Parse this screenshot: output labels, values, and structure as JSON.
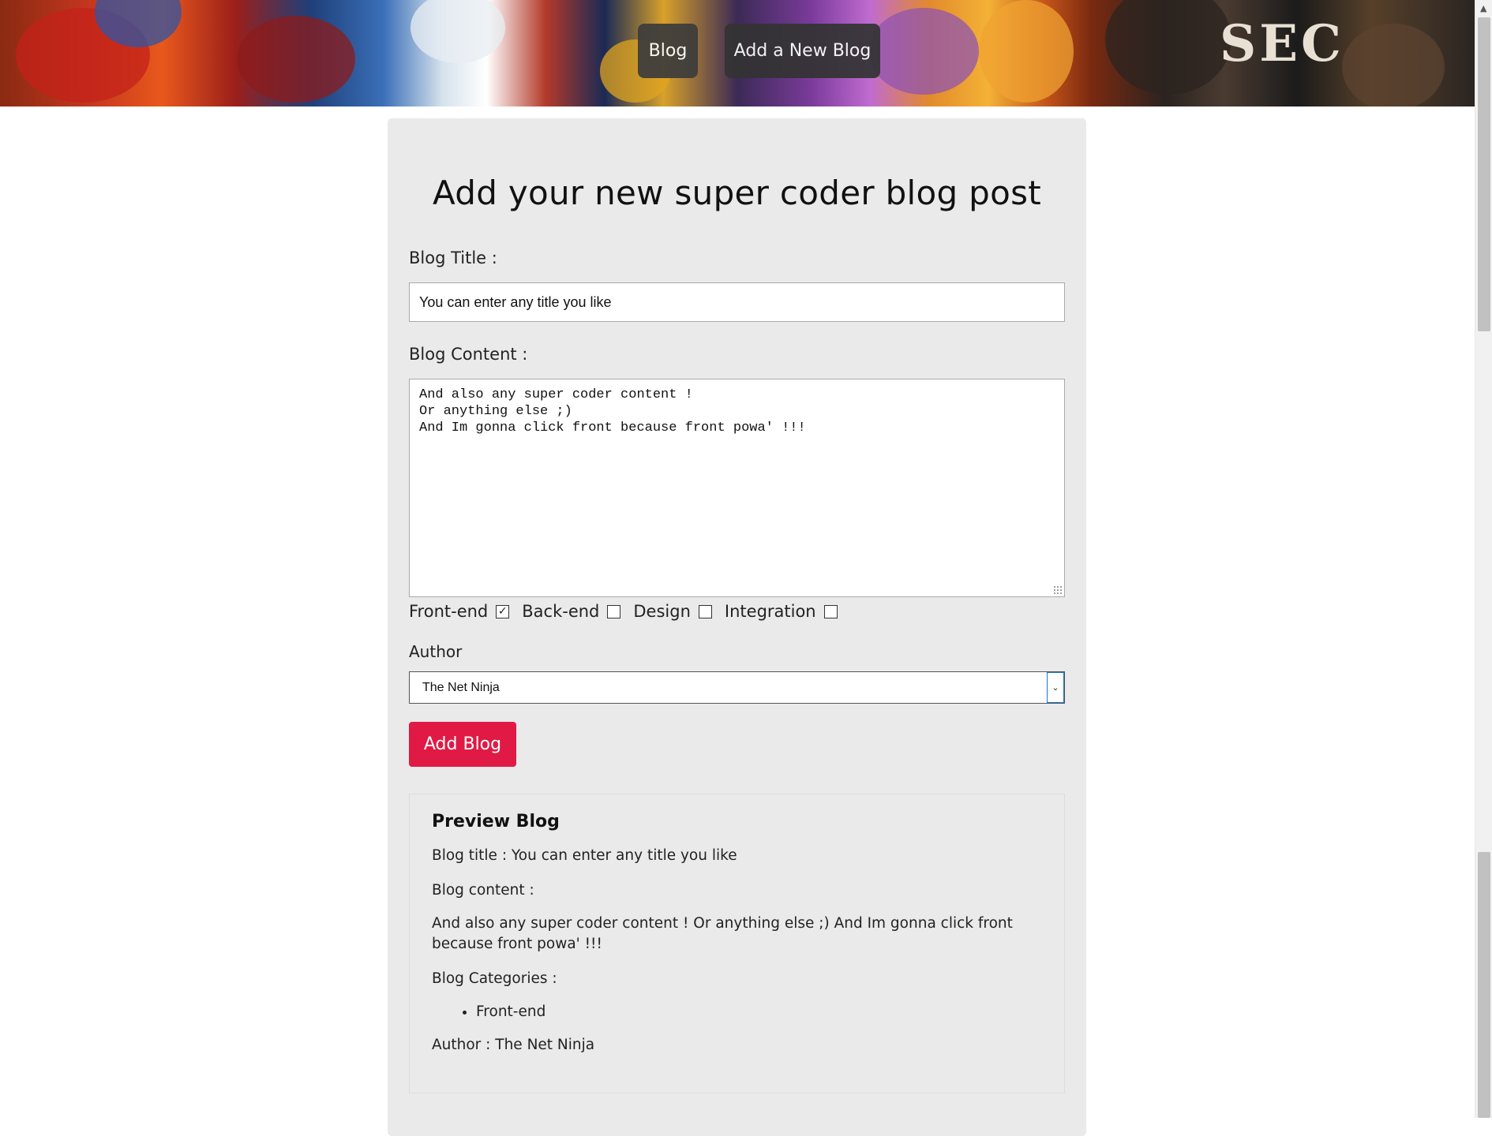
{
  "nav": {
    "blog_label": "Blog",
    "add_label": "Add a New Blog"
  },
  "form": {
    "heading": "Add your new super coder blog post",
    "title_label": "Blog Title :",
    "title_value": "You can enter any title you like",
    "content_label": "Blog Content :",
    "content_lines": [
      "And also any super coder content !",
      "Or anything else ;)",
      "And Im gonna click front because front powa' !!!"
    ],
    "categories": [
      {
        "label": "Front-end",
        "checked": true
      },
      {
        "label": "Back-end",
        "checked": false
      },
      {
        "label": "Design",
        "checked": false
      },
      {
        "label": "Integration",
        "checked": false
      }
    ],
    "author_label": "Author",
    "author_value": "The Net Ninja",
    "submit_label": "Add Blog"
  },
  "preview": {
    "heading": "Preview Blog",
    "title_line": "Blog title : You can enter any title you like",
    "content_label": "Blog content :",
    "content_text": "And also any super coder content ! Or anything else ;) And Im gonna click front because front powa' !!!",
    "categories_label": "Blog Categories :",
    "categories": [
      "Front-end"
    ],
    "author_line": "Author : The Net Ninja"
  },
  "colors": {
    "accent": "#e01a45",
    "nav_bg": "#3c3c3c",
    "card_bg": "#eaeaea"
  },
  "icons": {
    "select_arrow": "chevron-down-icon",
    "checked_box": "checkbox-checked-icon"
  }
}
